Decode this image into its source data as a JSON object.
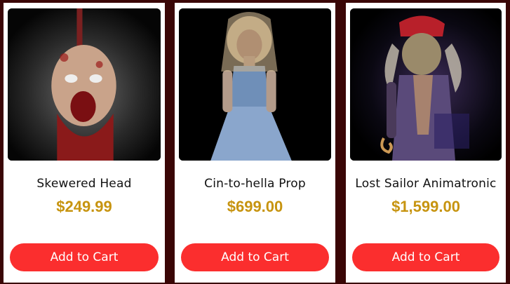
{
  "products": [
    {
      "name": "Skewered Head",
      "price": "$249.99",
      "button": "Add to Cart",
      "image": "skewered-head-product-photo"
    },
    {
      "name": "Cin-to-hella Prop",
      "price": "$699.00",
      "button": "Add to Cart",
      "image": "cin-to-hella-product-photo"
    },
    {
      "name": "Lost Sailor Animatronic",
      "price": "$1,599.00",
      "button": "Add to Cart",
      "image": "lost-sailor-product-photo"
    }
  ],
  "colors": {
    "page_background": "#3a0606",
    "card_background": "#ffffff",
    "price": "#c79410",
    "button": "#fb2e2e",
    "button_text": "#ffffff"
  }
}
